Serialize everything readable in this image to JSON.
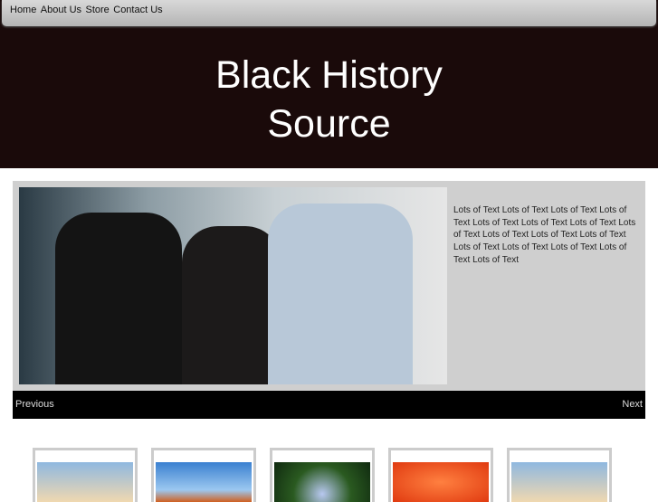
{
  "nav": {
    "items": [
      "Home",
      "About Us",
      "Store",
      "Contact Us"
    ]
  },
  "header": {
    "title_line1": "Black History",
    "title_line2": "Source"
  },
  "slider": {
    "description": "Lots of Text Lots of Text Lots of Text Lots of Text Lots of Text Lots of Text Lots of Text Lots of Text Lots of Text Lots of Text Lots of Text Lots of Text Lots of Text Lots of Text Lots of Text Lots of Text",
    "previous": "Previous",
    "next": "Next"
  },
  "thumbnails": [
    "lighthouse",
    "canyon",
    "hydrangea",
    "orange-flower",
    "lighthouse"
  ]
}
